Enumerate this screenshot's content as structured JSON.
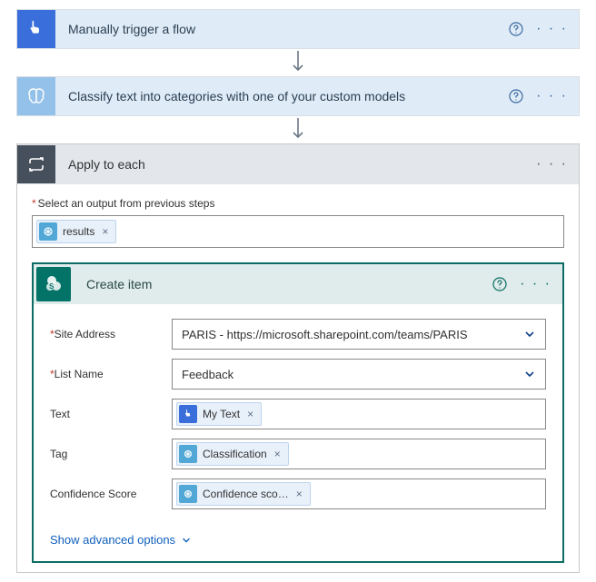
{
  "steps": {
    "trigger": {
      "title": "Manually trigger a flow"
    },
    "classify": {
      "title": "Classify text into categories with one of your custom models"
    },
    "apply": {
      "title": "Apply to each"
    }
  },
  "apply": {
    "select_output_label": "Select an output from previous steps",
    "token": {
      "label": "results"
    }
  },
  "create_item": {
    "title": "Create item",
    "rows": {
      "site_address": {
        "label": "Site Address",
        "value": "PARIS - https://microsoft.sharepoint.com/teams/PARIS"
      },
      "list_name": {
        "label": "List Name",
        "value": "Feedback"
      },
      "text": {
        "label": "Text",
        "token": "My Text"
      },
      "tag": {
        "label": "Tag",
        "token": "Classification"
      },
      "confidence": {
        "label": "Confidence Score",
        "token": "Confidence sco…"
      }
    },
    "advanced_link": "Show advanced options"
  },
  "glyphs": {
    "times": "×",
    "dots": "· · ·"
  }
}
